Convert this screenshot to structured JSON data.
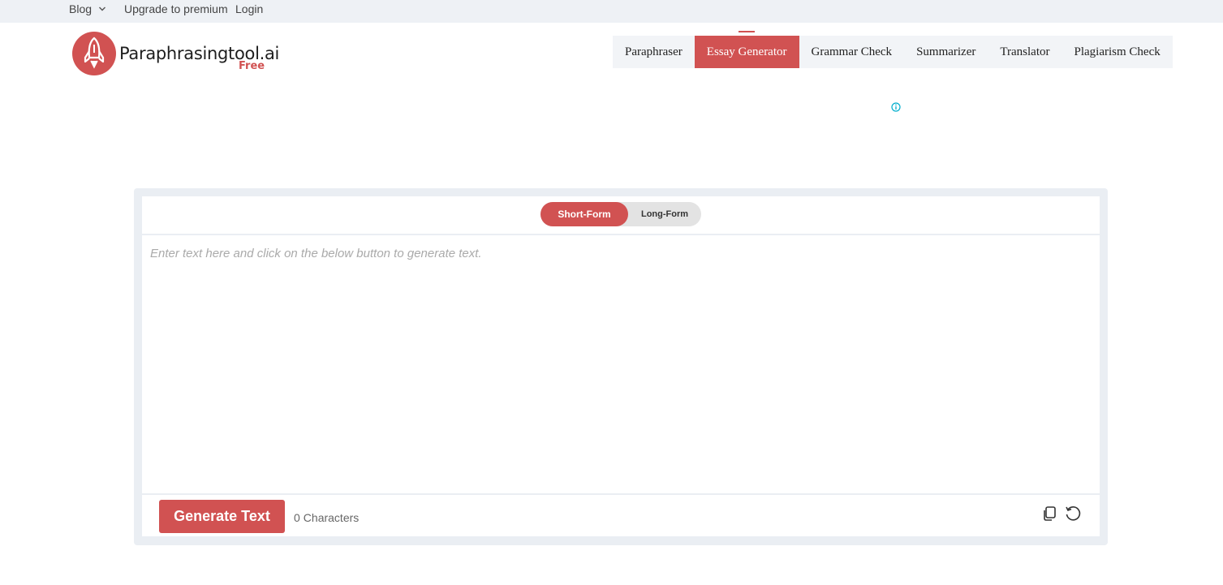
{
  "topbar": {
    "blog_label": "Blog",
    "blog_chevron_icon": "chevron-down-icon",
    "upgrade_label": "Upgrade to premium",
    "login_label": "Login"
  },
  "logo": {
    "name": "Paraphrasingtool.ai",
    "badge": "Free",
    "icon": "rocket-icon",
    "brand_color": "#d15252"
  },
  "nav": {
    "items": [
      {
        "label": "Paraphraser",
        "active": false
      },
      {
        "label": "Essay Generator",
        "active": true
      },
      {
        "label": "Grammar Check",
        "active": false
      },
      {
        "label": "Summarizer",
        "active": false
      },
      {
        "label": "Translator",
        "active": false
      },
      {
        "label": "Plagiarism Check",
        "active": false
      }
    ]
  },
  "ad": {
    "icon": "info-icon",
    "color": "#00aecd"
  },
  "tool": {
    "mode_short": "Short-Form",
    "mode_long": "Long-Form",
    "selected_mode": "Short-Form",
    "input_value": "",
    "input_placeholder": "Enter text here and click on the below button to generate text.",
    "generate_label": "Generate Text",
    "char_count": "0",
    "char_label": "Characters",
    "copy_icon": "copy-icon",
    "reset_icon": "reset-icon"
  }
}
